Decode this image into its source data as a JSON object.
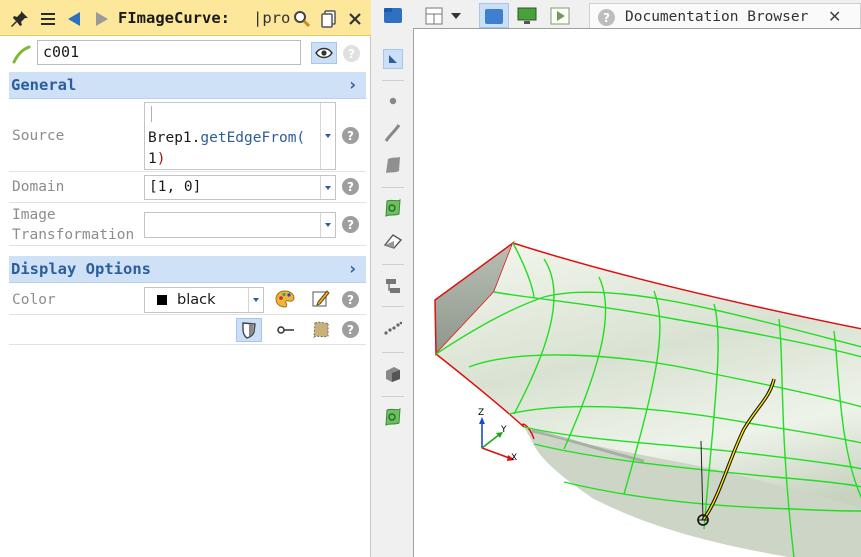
{
  "panel": {
    "title": "FImageCurve:",
    "title_tab": "|pro",
    "name": "c001"
  },
  "sections": {
    "general": "General",
    "display": "Display Options"
  },
  "properties": {
    "source": {
      "label": "Source",
      "prefix": "Brep1.",
      "call": "getEdgeFrom(",
      "arg": "1",
      "close": ")"
    },
    "domain": {
      "label": "Domain",
      "value": "[1, 0]"
    },
    "image_transformation": {
      "label_line1": "Image",
      "label_line2": "Transformation",
      "value": ""
    },
    "color": {
      "label": "Color",
      "value": "black",
      "swatch": "#000000"
    }
  },
  "help_glyph": "?",
  "chevron_glyph": "›",
  "tabs": {
    "documentation": "Documentation Browser",
    "close_glyph": "✕"
  },
  "axes": {
    "x": "X",
    "y": "Y",
    "z": "Z"
  },
  "colors": {
    "title_bg": "#fde79b",
    "section_bg": "#cfe1f6",
    "section_text": "#2c5d9c",
    "edge_green": "#22dd22",
    "edge_red": "#dd1111",
    "curve_yellow": "#ffe600"
  }
}
